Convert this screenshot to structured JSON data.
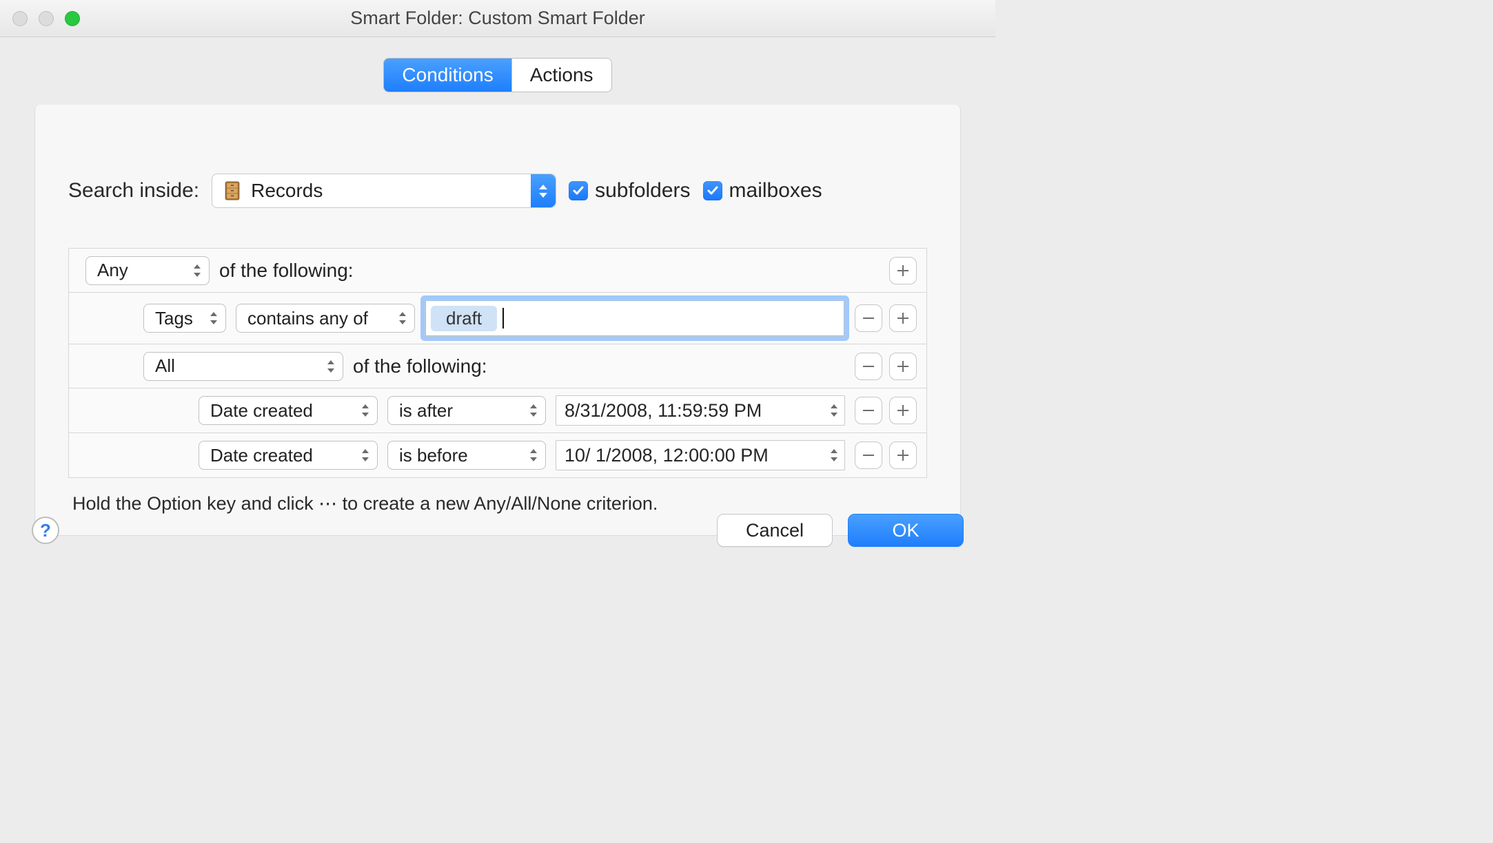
{
  "window": {
    "title": "Smart Folder: Custom Smart Folder"
  },
  "tabs": {
    "conditions": "Conditions",
    "actions": "Actions"
  },
  "search": {
    "label": "Search inside:",
    "folder": "Records",
    "subfolders_label": "subfolders",
    "subfolders_checked": true,
    "mailboxes_label": "mailboxes",
    "mailboxes_checked": true
  },
  "rules": {
    "header_match": "Any",
    "of_following": "of the following:",
    "rows": [
      {
        "field": "Tags",
        "operator": "contains any of",
        "token": "draft"
      }
    ],
    "group": {
      "match": "All",
      "rows": [
        {
          "field": "Date created",
          "operator": "is after",
          "value": "8/31/2008, 11:59:59 PM"
        },
        {
          "field": "Date created",
          "operator": "is before",
          "value": "10/  1/2008, 12:00:00 PM"
        }
      ]
    }
  },
  "hint": "Hold the Option key and click ⋯ to create a new Any/All/None criterion.",
  "buttons": {
    "cancel": "Cancel",
    "ok": "OK"
  }
}
